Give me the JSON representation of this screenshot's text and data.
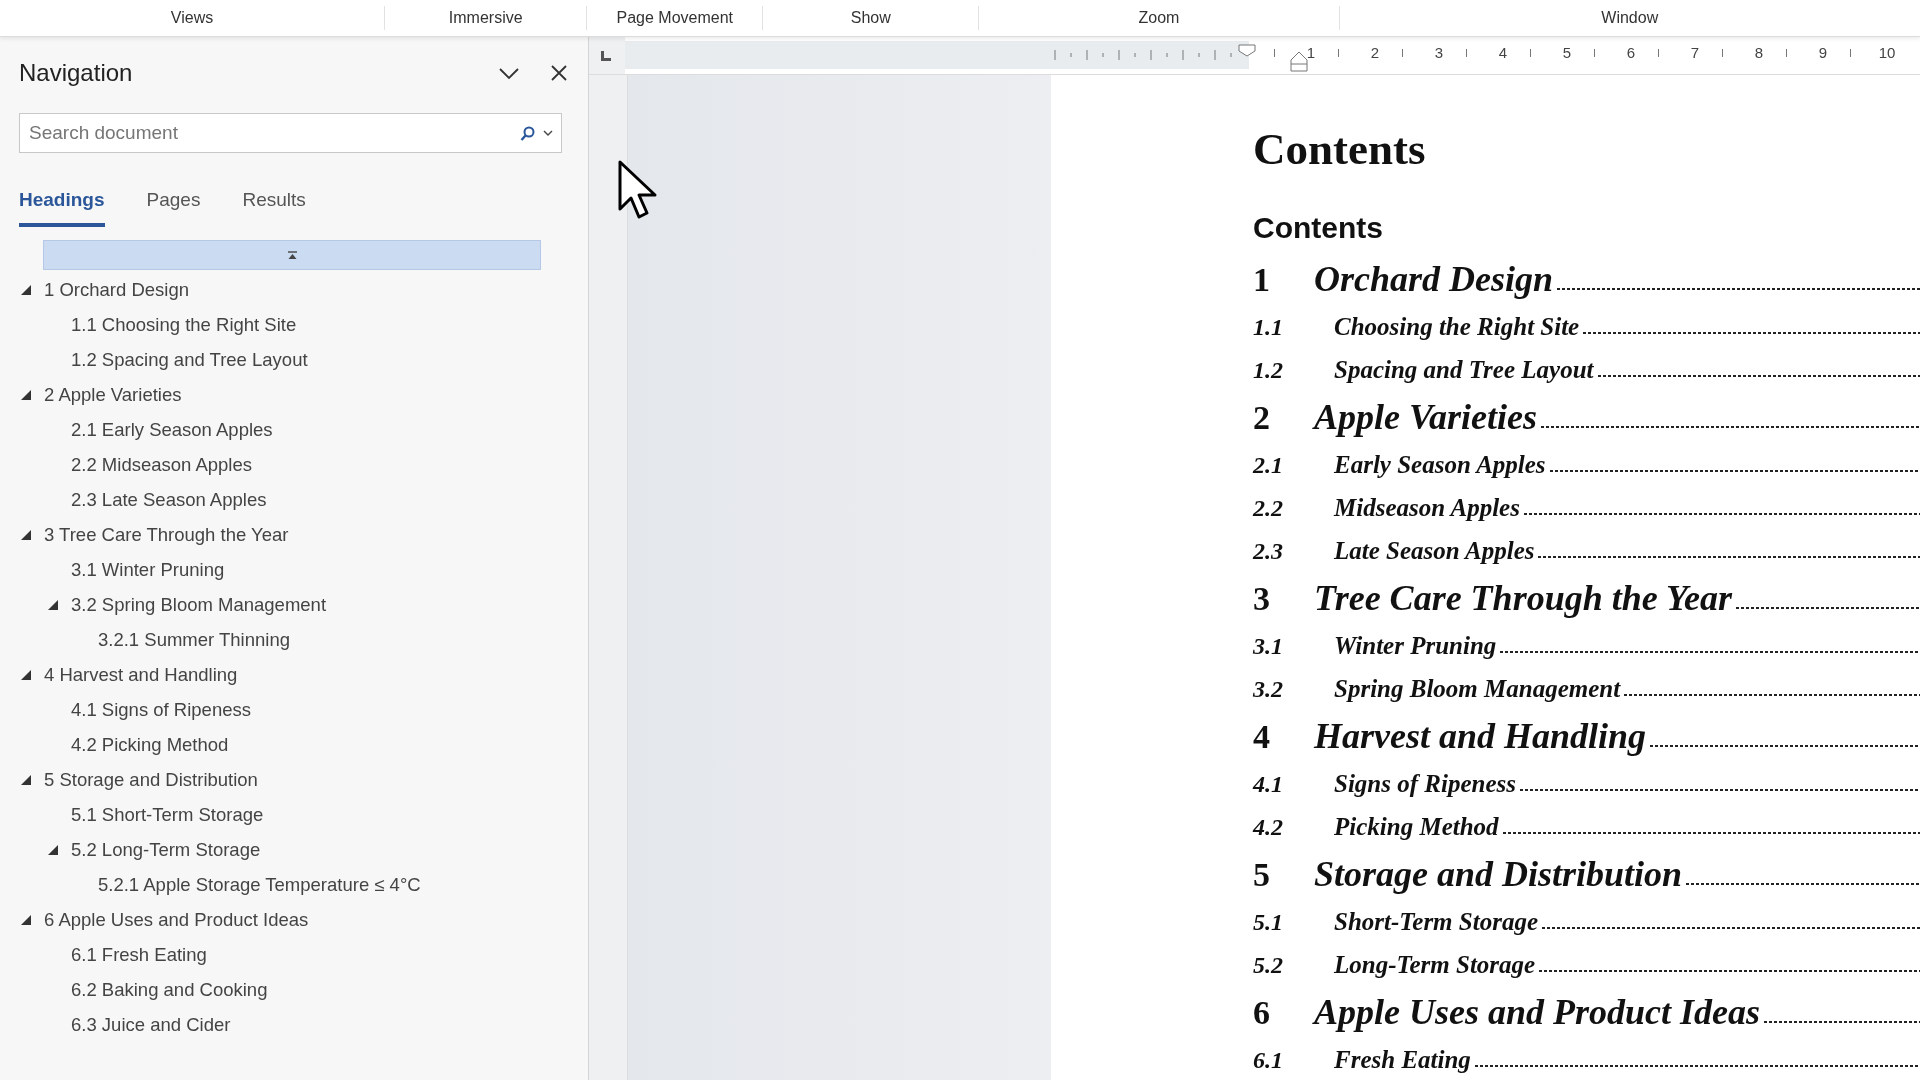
{
  "ribbon": {
    "groups": [
      "Views",
      "Immersive",
      "Page Movement",
      "Show",
      "Zoom",
      "Window"
    ]
  },
  "navigation": {
    "title": "Navigation",
    "search": {
      "placeholder": "Search document"
    },
    "tabs": [
      {
        "label": "Headings",
        "selected": true
      },
      {
        "label": "Pages",
        "selected": false
      },
      {
        "label": "Results",
        "selected": false
      }
    ],
    "tree": [
      {
        "label": "1 Orchard Design",
        "expanded": true,
        "children": [
          {
            "label": "1.1 Choosing the Right Site"
          },
          {
            "label": "1.2 Spacing and Tree Layout"
          }
        ]
      },
      {
        "label": "2 Apple Varieties",
        "expanded": true,
        "children": [
          {
            "label": "2.1 Early Season Apples"
          },
          {
            "label": "2.2 Midseason Apples"
          },
          {
            "label": "2.3 Late Season Apples"
          }
        ]
      },
      {
        "label": "3 Tree Care Through the Year",
        "expanded": true,
        "children": [
          {
            "label": "3.1 Winter Pruning"
          },
          {
            "label": "3.2 Spring Bloom Management",
            "expanded": true,
            "children": [
              {
                "label": "3.2.1 Summer Thinning"
              }
            ]
          }
        ]
      },
      {
        "label": "4 Harvest and Handling",
        "expanded": true,
        "children": [
          {
            "label": "4.1 Signs of Ripeness"
          },
          {
            "label": "4.2 Picking Method"
          }
        ]
      },
      {
        "label": "5 Storage and Distribution",
        "expanded": true,
        "children": [
          {
            "label": "5.1 Short-Term Storage"
          },
          {
            "label": "5.2 Long-Term Storage",
            "expanded": true,
            "children": [
              {
                "label": "5.2.1 Apple Storage Temperature ≤ 4°C"
              }
            ]
          }
        ]
      },
      {
        "label": "6 Apple Uses and Product Ideas",
        "expanded": true,
        "children": [
          {
            "label": "6.1 Fresh Eating"
          },
          {
            "label": "6.2 Baking and Cooking"
          },
          {
            "label": "6.3 Juice and Cider"
          }
        ]
      }
    ]
  },
  "ruler": {
    "labels": [
      "1",
      "2",
      "3",
      "4",
      "5",
      "6",
      "7",
      "8",
      "9",
      "10"
    ]
  },
  "document": {
    "title": "Contents",
    "toc_heading": "Contents",
    "toc": [
      {
        "number": "1",
        "title": "Orchard Design",
        "kind": "level1"
      },
      {
        "number": "1.1",
        "title": "Choosing the Right Site",
        "kind": "level2"
      },
      {
        "number": "1.2",
        "title": "Spacing and Tree Layout",
        "kind": "level2"
      },
      {
        "number": "2",
        "title": "Apple Varieties",
        "kind": "level1"
      },
      {
        "number": "2.1",
        "title": "Early Season Apples",
        "kind": "level2"
      },
      {
        "number": "2.2",
        "title": "Midseason Apples",
        "kind": "level2"
      },
      {
        "number": "2.3",
        "title": "Late Season Apples",
        "kind": "level2"
      },
      {
        "number": "3",
        "title": "Tree Care Through the Year",
        "kind": "level1"
      },
      {
        "number": "3.1",
        "title": "Winter Pruning",
        "kind": "level2"
      },
      {
        "number": "3.2",
        "title": "Spring Bloom Management",
        "kind": "level2"
      },
      {
        "number": "4",
        "title": "Harvest and Handling",
        "kind": "level1"
      },
      {
        "number": "4.1",
        "title": "Signs of Ripeness",
        "kind": "level2"
      },
      {
        "number": "4.2",
        "title": "Picking Method",
        "kind": "level2"
      },
      {
        "number": "5",
        "title": "Storage and Distribution",
        "kind": "level1"
      },
      {
        "number": "5.1",
        "title": "Short-Term Storage",
        "kind": "level2"
      },
      {
        "number": "5.2",
        "title": "Long-Term Storage",
        "kind": "level2"
      },
      {
        "number": "6",
        "title": "Apple Uses and Product Ideas",
        "kind": "level1"
      },
      {
        "number": "6.1",
        "title": "Fresh Eating",
        "kind": "level2"
      }
    ]
  }
}
